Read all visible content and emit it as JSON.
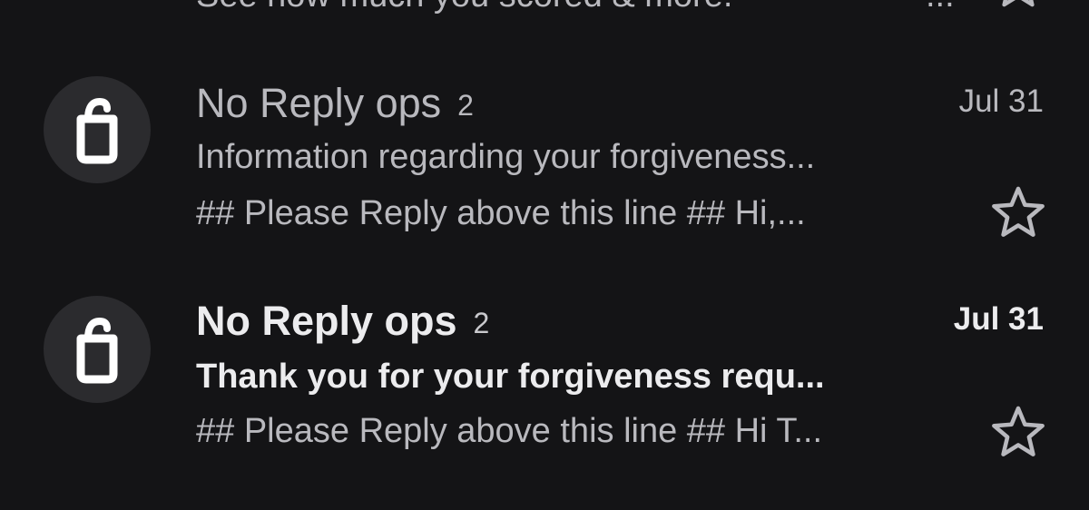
{
  "partial_row": {
    "snippet": "See how much you scored & more.",
    "more": "...",
    "star_icon": "star-outline-icon"
  },
  "emails": [
    {
      "sender": "No Reply ops",
      "count": "2",
      "date": "Jul 31",
      "subject": "Information regarding your forgiveness...",
      "snippet": "## Please Reply above this line ## Hi,...",
      "read": true,
      "avatar_icon": "shopping-bag-logo-icon",
      "star_icon": "star-outline-icon"
    },
    {
      "sender": "No Reply ops",
      "count": "2",
      "date": "Jul 31",
      "subject": "Thank you for your forgiveness requ...",
      "snippet": "## Please Reply above this line ## Hi T...",
      "read": false,
      "avatar_icon": "shopping-bag-logo-icon",
      "star_icon": "star-outline-icon"
    }
  ],
  "colors": {
    "background": "#141416",
    "avatar_bg": "#2b2b2e",
    "text_read": "#b9b9be",
    "text_unread": "#ececee",
    "icon": "#ffffff"
  }
}
